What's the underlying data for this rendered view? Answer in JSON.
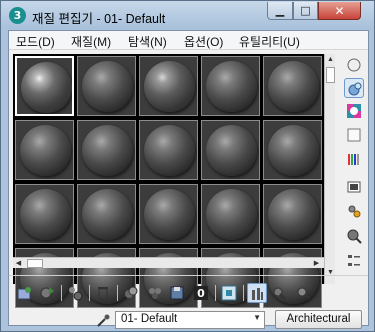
{
  "window": {
    "app_icon": "3",
    "title": "재질 편집기 - 01- Default",
    "minimize_glyph": "▁",
    "maximize_glyph": "□",
    "close_glyph": "✕"
  },
  "menu": {
    "items": [
      "모드(D)",
      "재질(M)",
      "탐색(N)",
      "옵션(O)",
      "유틸리티(U)"
    ]
  },
  "sample_slots": {
    "rows": 4,
    "columns": 5,
    "selected_index": 0
  },
  "right_toolbar": {
    "icons": [
      "sample-type-sphere-icon",
      "backlight-icon",
      "background-checker-icon",
      "sample-uv-tiling-icon",
      "video-color-check-icon",
      "make-preview-icon",
      "options-icon",
      "select-by-material-icon",
      "material-map-navigator-icon"
    ]
  },
  "bottom_toolbar": {
    "icons": [
      "get-material-icon",
      "put-material-icon",
      "assign-material-icon",
      "reset-map-icon",
      "copy-material-icon",
      "make-unique-icon",
      "put-to-library-icon",
      "material-id-channel-icon",
      "show-in-viewport-icon",
      "show-end-result-icon",
      "go-to-parent-icon",
      "go-forward-icon"
    ],
    "material_id_channel_value": "0"
  },
  "name_row": {
    "material_name": "01- Default",
    "material_type": "Architectural"
  },
  "colors": {
    "selection_border": "#ffffff",
    "slot_background": "#3c3c3c",
    "title_bar": "#abc3dc",
    "close_button": "#c8433a"
  }
}
